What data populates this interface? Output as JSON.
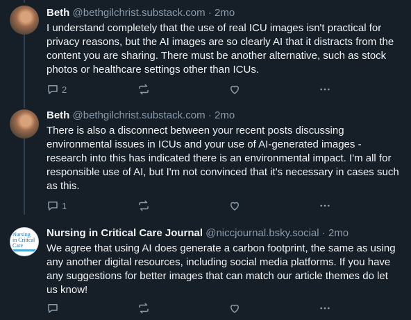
{
  "posts": [
    {
      "author": "Beth",
      "handle": "@bethgilchrist.substack.com",
      "separator": "·",
      "time": "2mo",
      "text": "I understand completely that the use of real ICU images isn't practical for privacy reasons, but the AI images are so clearly AI that it distracts from the content you are sharing. There must be another alternative, such as stock photos or healthcare settings other than ICUs.",
      "reply_count": "2",
      "avatar": "beth-avatar"
    },
    {
      "author": "Beth",
      "handle": "@bethgilchrist.substack.com",
      "separator": "·",
      "time": "2mo",
      "text": "There is also a disconnect between your recent posts discussing environmental issues in ICUs and your use of AI-generated images - research into this has indicated there is an environmental impact. I'm all for responsible use of AI, but I'm not convinced that it's necessary in cases such as this.",
      "reply_count": "1",
      "avatar": "beth-avatar"
    },
    {
      "author": "Nursing in Critical Care Journal",
      "handle": "@niccjournal.bsky.social",
      "separator": "·",
      "time": "2mo",
      "text": "We agree that using AI does generate a carbon footprint, the same as using any another digital resources, including social media platforms. If you have any suggestions for better images that can match our article themes do let us know!",
      "reply_count": "",
      "avatar": "journal-avatar"
    }
  ],
  "journal_avatar": {
    "line1": "Nursing",
    "line2": "in Critical",
    "line3": "Care"
  },
  "icons": [
    "reply-icon",
    "repost-icon",
    "like-icon",
    "more-icon"
  ],
  "colors": {
    "background": "#161e27",
    "text": "#f1f3f5",
    "muted": "#8a9bab",
    "thread_line": "#2e4052"
  }
}
